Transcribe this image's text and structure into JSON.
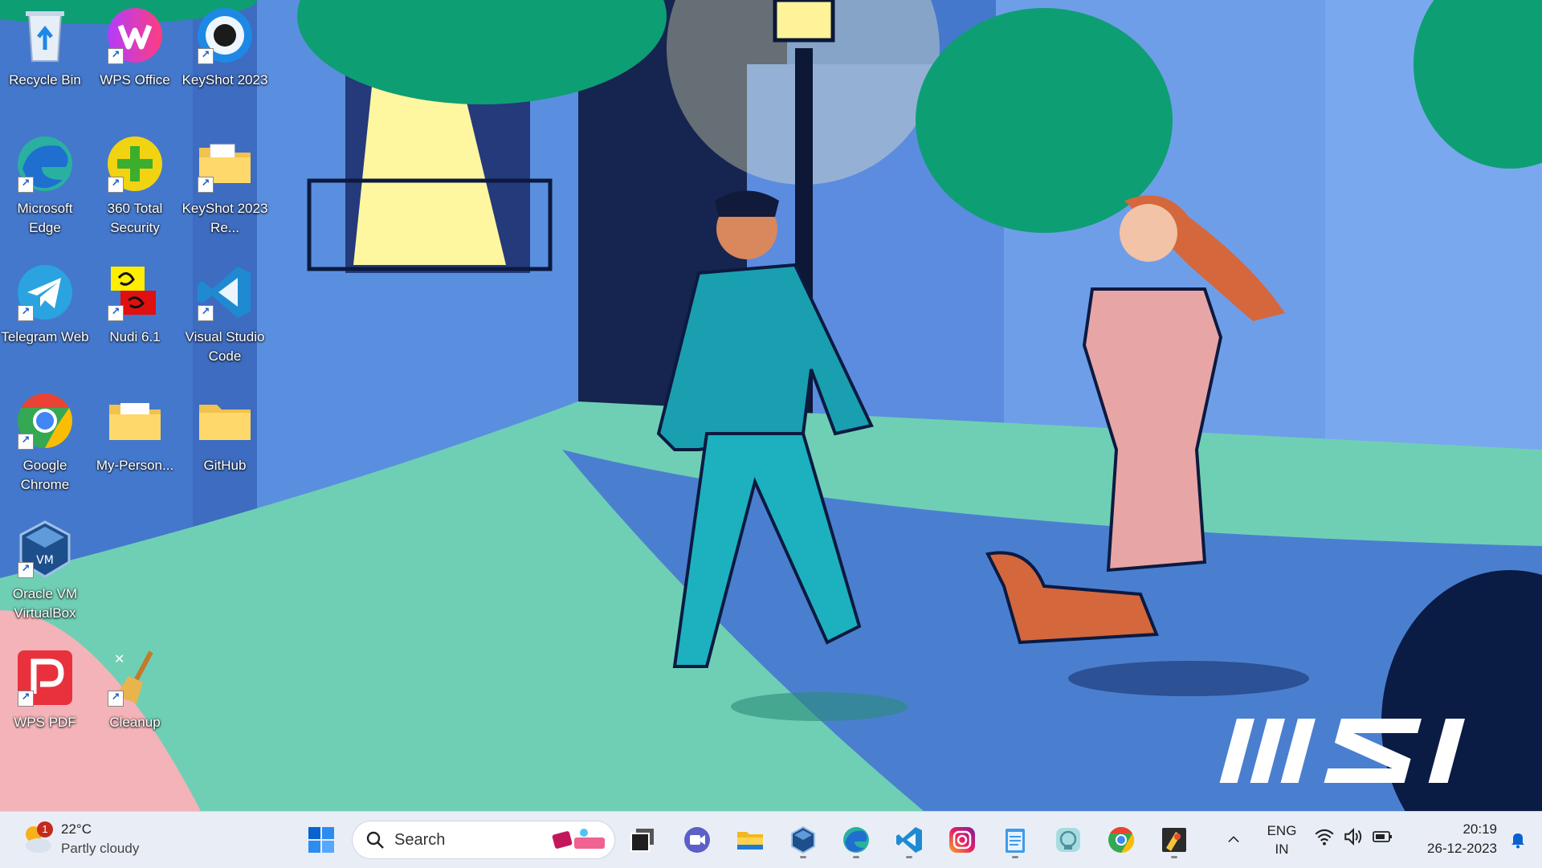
{
  "desktop": {
    "icons": [
      {
        "label": "Recycle Bin",
        "icon": "recycle-bin-icon"
      },
      {
        "label": "WPS Office",
        "icon": "wps-office-icon"
      },
      {
        "label": "KeyShot 2023",
        "icon": "keyshot-icon"
      },
      {
        "label": "Microsoft Edge",
        "icon": "edge-icon"
      },
      {
        "label": "360 Total Security",
        "icon": "360-security-icon"
      },
      {
        "label": "KeyShot 2023 Re...",
        "icon": "folder-icon"
      },
      {
        "label": "Telegram Web",
        "icon": "telegram-icon"
      },
      {
        "label": "Nudi 6.1",
        "icon": "nudi-icon"
      },
      {
        "label": "Visual Studio Code",
        "icon": "vscode-icon"
      },
      {
        "label": "Google Chrome",
        "icon": "chrome-icon"
      },
      {
        "label": "My-Person...",
        "icon": "folder-icon"
      },
      {
        "label": "GitHub",
        "icon": "folder-icon"
      },
      {
        "label": "Oracle VM VirtualBox",
        "icon": "virtualbox-icon"
      },
      {
        "label": "WPS PDF",
        "icon": "wps-pdf-icon"
      },
      {
        "label": "Cleanup",
        "icon": "broom-icon"
      }
    ],
    "wallpaper_brand": "MSI"
  },
  "taskbar": {
    "weather": {
      "temp": "22°C",
      "condition": "Partly cloudy",
      "badge": "1"
    },
    "search": {
      "placeholder": "Search"
    },
    "pinned": [
      "windows-start-icon",
      "task-view-icon",
      "meet-icon",
      "file-explorer-icon",
      "virtualbox-icon",
      "edge-icon",
      "vscode-icon",
      "instagram-icon",
      "notepad-icon",
      "copilot-icon",
      "chrome-icon",
      "python-idle-icon"
    ],
    "tray": {
      "language_top": "ENG",
      "language_bottom": "IN",
      "time": "20:19",
      "date": "26-12-2023"
    }
  },
  "colors": {
    "sky": "#3f6fc1",
    "path": "#6fcfb5",
    "taskbar": "#e9eef6",
    "accent": "#0a62d1"
  }
}
